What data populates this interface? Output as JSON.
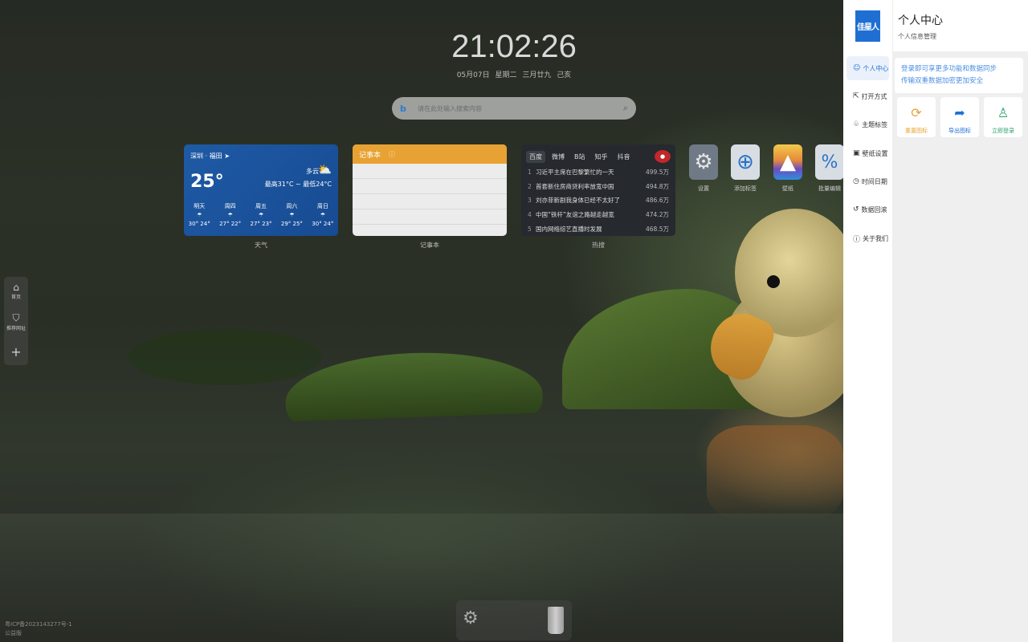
{
  "clock": {
    "time": "21:02:26",
    "date": "05月07日",
    "weekday": "星期二",
    "lunar": "三月廿九",
    "ganzhi": "己亥"
  },
  "search": {
    "placeholder": "请在此处输入搜索内容",
    "engine_icon": "bing-icon"
  },
  "weather": {
    "location": "深圳 · 福田",
    "temp": "25°",
    "condition": "多云",
    "range": "最高31°C ~ 最低24°C",
    "forecast": [
      {
        "day": "明天",
        "icon": "rain",
        "temps": "30° 24°"
      },
      {
        "day": "周四",
        "icon": "rain",
        "temps": "27° 22°"
      },
      {
        "day": "周五",
        "icon": "rain",
        "temps": "27° 23°"
      },
      {
        "day": "周六",
        "icon": "rain",
        "temps": "29° 25°"
      },
      {
        "day": "周日",
        "icon": "rain",
        "temps": "30° 24°"
      }
    ],
    "label": "天气"
  },
  "notepad": {
    "title": "记事本",
    "label": "记事本"
  },
  "hot": {
    "tabs": [
      "百度",
      "微博",
      "B站",
      "知乎",
      "抖音"
    ],
    "active_tab": "百度",
    "items": [
      {
        "n": "1",
        "title": "习近平主席在巴黎繁忙的一天",
        "v": "499.5万"
      },
      {
        "n": "2",
        "title": "首套新住房商贷利率放宽中国",
        "v": "494.8万"
      },
      {
        "n": "3",
        "title": "刘亦菲新剧我身体已经不太好了",
        "v": "486.6万"
      },
      {
        "n": "4",
        "title": "中国“铁杆”友谊之路越走越宽",
        "v": "474.2万"
      },
      {
        "n": "5",
        "title": "国内网络综艺直播时发展",
        "v": "468.5万"
      }
    ],
    "label": "热搜"
  },
  "apps": [
    {
      "label": "设置",
      "icon": "settings-icon"
    },
    {
      "label": "添加标签",
      "icon": "add-icon"
    },
    {
      "label": "壁纸",
      "icon": "wallpaper-icon"
    },
    {
      "label": "批量编辑",
      "icon": "percent-icon"
    }
  ],
  "left_dock": [
    {
      "label": "首页",
      "icon": "home-icon"
    },
    {
      "label": "推荐网址",
      "icon": "shield-icon"
    },
    {
      "label": "",
      "icon": "plus-icon"
    }
  ],
  "bottom_dock": [
    {
      "icon": "settings-icon"
    },
    {
      "icon": "trash-icon"
    }
  ],
  "footer": {
    "icp": "粤ICP备2023143277号-1",
    "extra": "公益版"
  },
  "logo": {
    "text": "佳星人"
  },
  "menu": [
    {
      "label": "个人中心",
      "icon": "user-icon",
      "active": true
    },
    {
      "label": "打开方式",
      "icon": "external-link-icon"
    },
    {
      "label": "主题标签",
      "icon": "shirt-icon"
    },
    {
      "label": "壁纸设置",
      "icon": "image-icon"
    },
    {
      "label": "时间日期",
      "icon": "clock-icon"
    },
    {
      "label": "数据回滚",
      "icon": "history-icon"
    },
    {
      "label": "关于我们",
      "icon": "info-icon"
    }
  ],
  "panel": {
    "title": "个人中心",
    "subtitle": "个人信息管理",
    "info_line1": "登录即可享更多功能和数据同步",
    "info_line2": "传输双重数据加密更加安全",
    "actions": [
      {
        "label": "重置图标",
        "icon": "refresh-icon",
        "color": "#e8a233"
      },
      {
        "label": "导出图标",
        "icon": "share-icon",
        "color": "#1e6fd6"
      },
      {
        "label": "立即登录",
        "icon": "user-icon",
        "color": "#2aa06a"
      }
    ]
  }
}
